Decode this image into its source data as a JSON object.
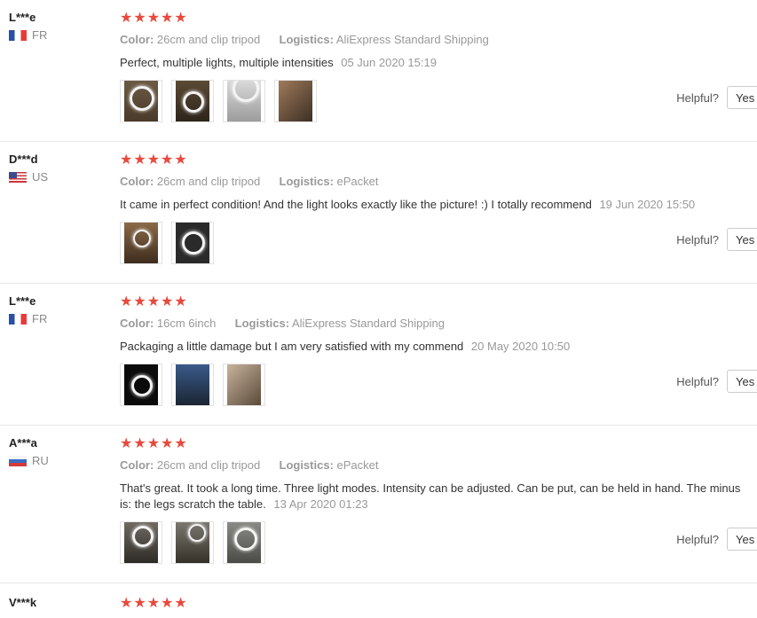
{
  "reviews": [
    {
      "user": "L***e",
      "country": "FR",
      "flag": "fr",
      "stars": "★★★★★",
      "color_label": "Color:",
      "color_value": "26cm and clip tripod",
      "logistics_label": "Logistics:",
      "logistics_value": "AliExpress Standard Shipping",
      "feedback": "Perfect, multiple lights, multiple intensities",
      "date": "05 Jun 2020 15:19",
      "photo_count": 4,
      "helpful_label": "Helpful?",
      "yes_label": "Yes"
    },
    {
      "user": "D***d",
      "country": "US",
      "flag": "us",
      "stars": "★★★★★",
      "color_label": "Color:",
      "color_value": "26cm and clip tripod",
      "logistics_label": "Logistics:",
      "logistics_value": "ePacket",
      "feedback": "It came in perfect condition! And the light looks exactly like the picture! :) I totally recommend",
      "date": "19 Jun 2020 15:50",
      "photo_count": 2,
      "helpful_label": "Helpful?",
      "yes_label": "Yes"
    },
    {
      "user": "L***e",
      "country": "FR",
      "flag": "fr",
      "stars": "★★★★★",
      "color_label": "Color:",
      "color_value": "16cm 6inch",
      "logistics_label": "Logistics:",
      "logistics_value": "AliExpress Standard Shipping",
      "feedback": "Packaging a little damage but I am very satisfied with my commend",
      "date": "20 May 2020 10:50",
      "photo_count": 3,
      "helpful_label": "Helpful?",
      "yes_label": "Yes"
    },
    {
      "user": "A***a",
      "country": "RU",
      "flag": "ru",
      "stars": "★★★★★",
      "color_label": "Color:",
      "color_value": "26cm and clip tripod",
      "logistics_label": "Logistics:",
      "logistics_value": "ePacket",
      "feedback": "That's great. It took a long time. Three light modes. Intensity can be adjusted. Can be put, can be held in hand. The minus is: the legs scratch the table.",
      "date": "13 Apr 2020 01:23",
      "photo_count": 3,
      "helpful_label": "Helpful?",
      "yes_label": "Yes"
    },
    {
      "user": "V***k",
      "stars": "★★★★★"
    }
  ],
  "colors": {
    "star": "#e9493d",
    "muted": "#999999",
    "divider": "#e5e5e5"
  }
}
